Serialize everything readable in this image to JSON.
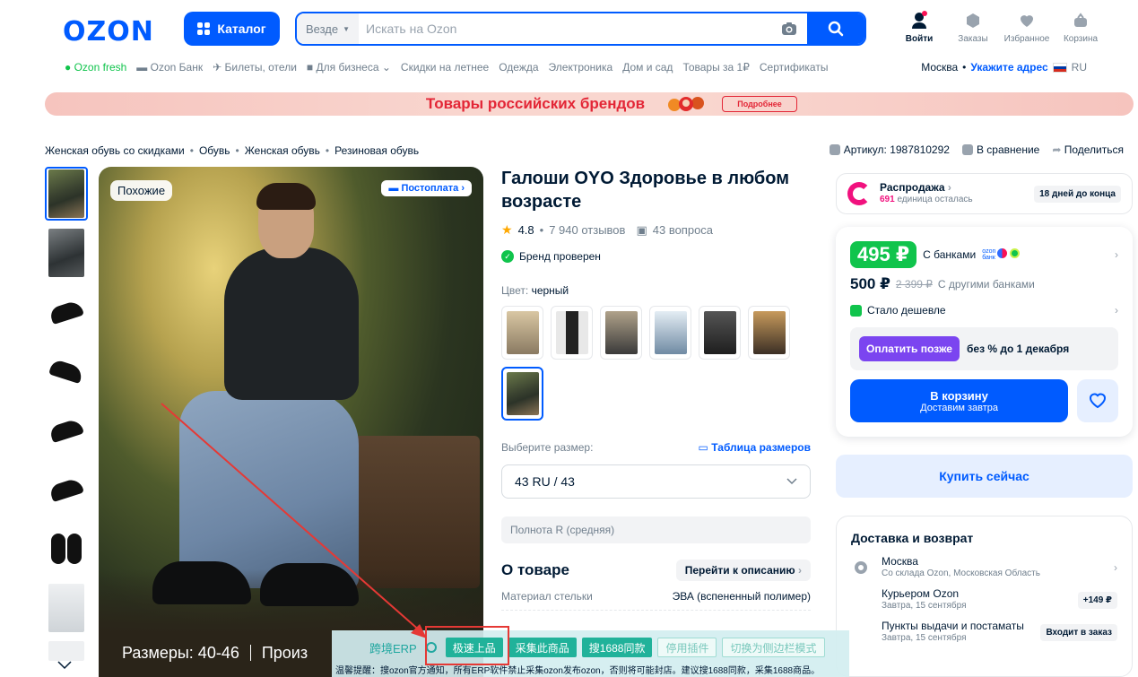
{
  "header": {
    "logo": "OZON",
    "catalog_label": "Каталог",
    "search_scope": "Везде",
    "search_placeholder": "Искать на Ozon",
    "icons": [
      {
        "label": "Войти",
        "icon": "user-icon"
      },
      {
        "label": "Заказы",
        "icon": "box-icon"
      },
      {
        "label": "Избранное",
        "icon": "heart-icon"
      },
      {
        "label": "Корзина",
        "icon": "cart-icon"
      }
    ]
  },
  "subnav": {
    "items": [
      "Ozon fresh",
      "Ozon Банк",
      "Билеты, отели",
      "Для бизнеса",
      "Скидки на летнее",
      "Одежда",
      "Электроника",
      "Дом и сад",
      "Товары за 1₽",
      "Сертификаты"
    ],
    "city": "Москва",
    "address_link": "Укажите адрес",
    "lang": "RU"
  },
  "banner": {
    "title": "Товары российских брендов",
    "button": "Подробнее"
  },
  "breadcrumbs": [
    "Женская обувь со скидками",
    "Обувь",
    "Женская обувь",
    "Резиновая обувь"
  ],
  "meta": {
    "article": "Артикул: 1987810292",
    "compare": "В сравнение",
    "share": "Поделиться"
  },
  "gallery": {
    "tag_similar": "Похожие",
    "tag_postpay": "Постоплата",
    "caption_left": "Размеры: 40-46",
    "caption_right": "Произ"
  },
  "product": {
    "title": "Галоши OYO Здоровье в любом возрасте",
    "rating": "4.8",
    "reviews": "7 940 отзывов",
    "questions": "43 вопроса",
    "brand_verified": "Бренд проверен",
    "color_label": "Цвет:",
    "color_value": "черный",
    "size_label": "Выберите размер:",
    "size_table": "Таблица размеров",
    "size_selected": "43 RU / 43",
    "fullness": "Полнота R (средняя)",
    "about_title": "О товаре",
    "about_link": "Перейти к описанию",
    "spec_key": "Материал стельки",
    "spec_value": "ЭВА (вспененный полимер)"
  },
  "sale": {
    "title": "Распродажа",
    "count": "691",
    "count_text": "единица осталась",
    "days": "18 дней до конца"
  },
  "price": {
    "card_price": "495 ₽",
    "card_note": "С банками",
    "bank_label": "ozon банк",
    "regular_price": "500 ₽",
    "old_price": "2 399 ₽",
    "regular_note": "С другими банками",
    "cheaper": "Стало дешевле",
    "pay_later_btn": "Оплатить позже",
    "pay_later_text": "без % до 1 декабря",
    "cart_label": "В корзину",
    "cart_sub": "Доставим завтра",
    "buy_now": "Купить сейчас"
  },
  "delivery": {
    "title": "Доставка и возврат",
    "city": "Москва",
    "city_sub": "Со склада Ozon, Московская Область",
    "courier": "Курьером Ozon",
    "courier_sub": "Завтра, 15 сентября",
    "courier_price": "+149 ₽",
    "pickup": "Пункты выдачи и постаматы",
    "pickup_sub": "Завтра, 15 сентября",
    "pickup_tag": "Входит в заказ"
  },
  "erp": {
    "brand": "跨境ERP",
    "buttons": [
      "极速上品",
      "采集此商品",
      "搜1688同款",
      "停用插件",
      "切换为侧边栏模式"
    ],
    "note": "温馨提醒：搜ozon官方通知，所有ERP软件禁止采集ozon发布ozon，否则将可能封店。建议搜1688同款，采集1688商品。"
  },
  "colors": {
    "brand": "#005bff",
    "green": "#10c44c",
    "sale_pink": "#f1117e",
    "erp_teal": "#20b29a",
    "annotation_red": "#e53935"
  }
}
